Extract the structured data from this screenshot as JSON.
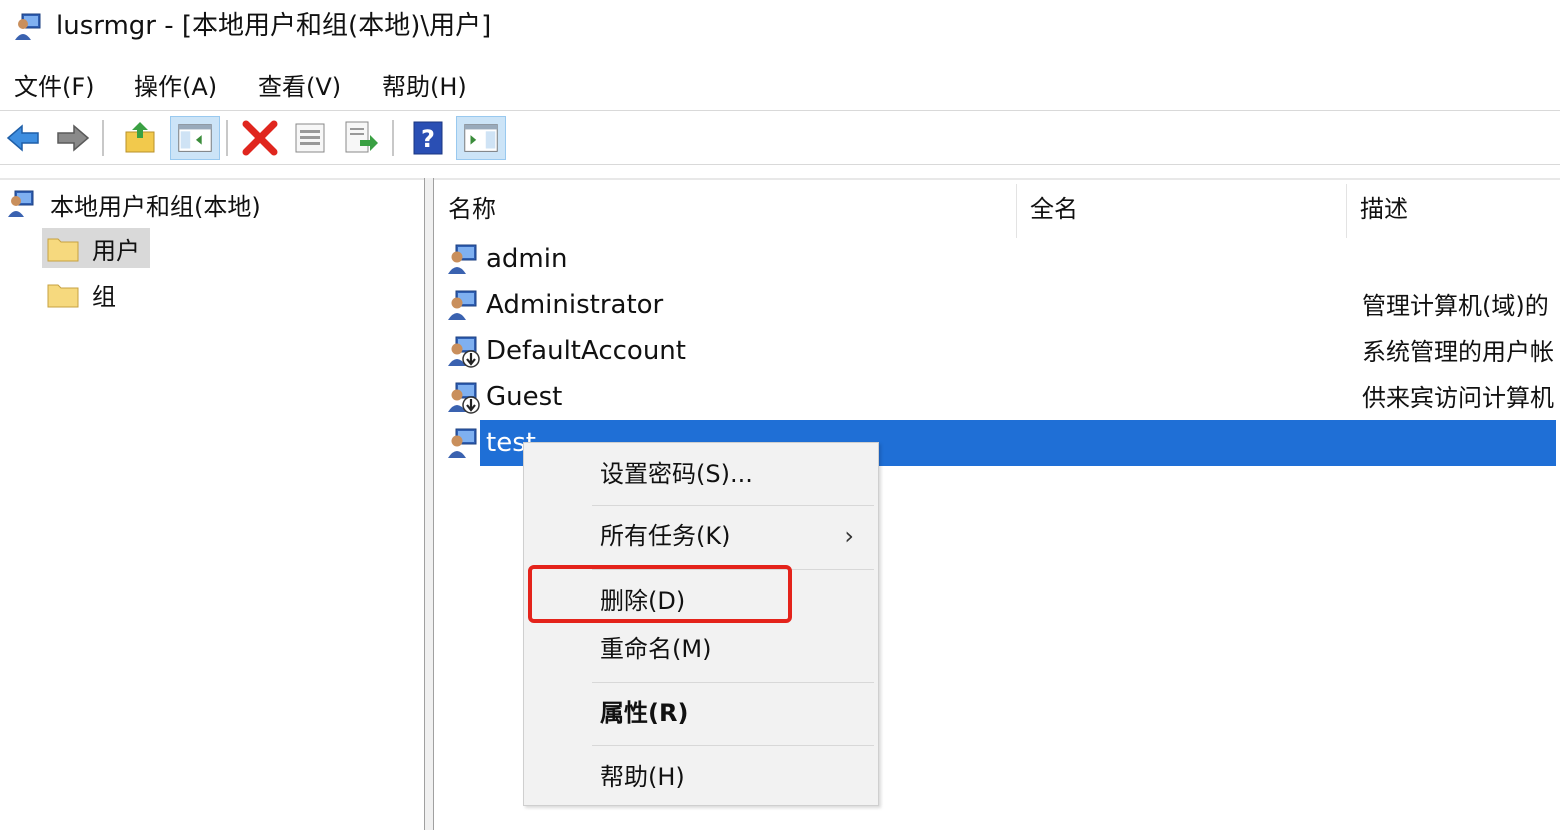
{
  "window": {
    "title": "lusrmgr - [本地用户和组(本地)\\用户]"
  },
  "menu": [
    "文件(F)",
    "操作(A)",
    "查看(V)",
    "帮助(H)"
  ],
  "toolbar": [
    {
      "name": "back-icon"
    },
    {
      "name": "forward-icon"
    },
    {
      "name": "up-folder-icon"
    },
    {
      "name": "show-hide-tree-icon",
      "pressed": true
    },
    {
      "name": "delete-icon"
    },
    {
      "name": "properties-icon"
    },
    {
      "name": "export-list-icon"
    },
    {
      "name": "help-icon"
    },
    {
      "name": "action-pane-icon",
      "pressed": true
    }
  ],
  "tree": {
    "root": "本地用户和组(本地)",
    "items": [
      {
        "label": "用户",
        "selected": true
      },
      {
        "label": "组",
        "selected": false
      }
    ]
  },
  "list": {
    "columns": [
      "名称",
      "全名",
      "描述"
    ],
    "rows": [
      {
        "name": "admin",
        "full_name": "",
        "description": "",
        "disabled": false
      },
      {
        "name": "Administrator",
        "full_name": "",
        "description": "管理计算机(域)的",
        "disabled": false
      },
      {
        "name": "DefaultAccount",
        "full_name": "",
        "description": "系统管理的用户帐",
        "disabled": true
      },
      {
        "name": "Guest",
        "full_name": "",
        "description": "供来宾访问计算机",
        "disabled": true
      },
      {
        "name": "test",
        "full_name": "",
        "description": "",
        "disabled": false,
        "selected": true
      }
    ]
  },
  "context_menu": {
    "items": [
      "设置密码(S)...",
      "所有任务(K)",
      "删除(D)",
      "重命名(M)",
      "属性(R)",
      "帮助(H)"
    ],
    "submenu_arrow": "›"
  },
  "colors": {
    "selection": "#1f6fd6",
    "highlight_box": "#e4231b"
  }
}
